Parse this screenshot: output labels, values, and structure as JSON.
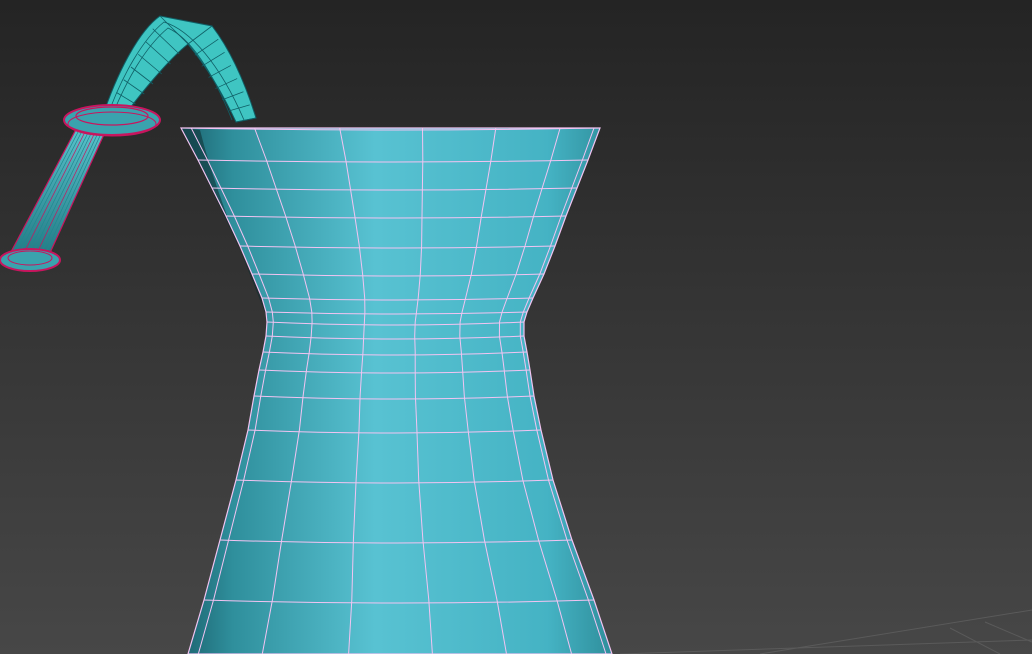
{
  "viewport": {
    "background_top": "#242424",
    "background_bottom": "#474747",
    "grid_color": "#5a5a5a"
  },
  "objects": {
    "vase": {
      "surface_color": "#45b3c4",
      "surface_dark": "#1c6470",
      "surface_light": "#58c2d2",
      "wire_color": "#f2c4f2"
    },
    "straw": {
      "band_color": "#3fc5c2",
      "band_dark": "#1f8a8e",
      "wire_color": "#0f5f66",
      "tube_color": "#3aa3ae",
      "selected_wire_color": "#c8155e"
    }
  }
}
